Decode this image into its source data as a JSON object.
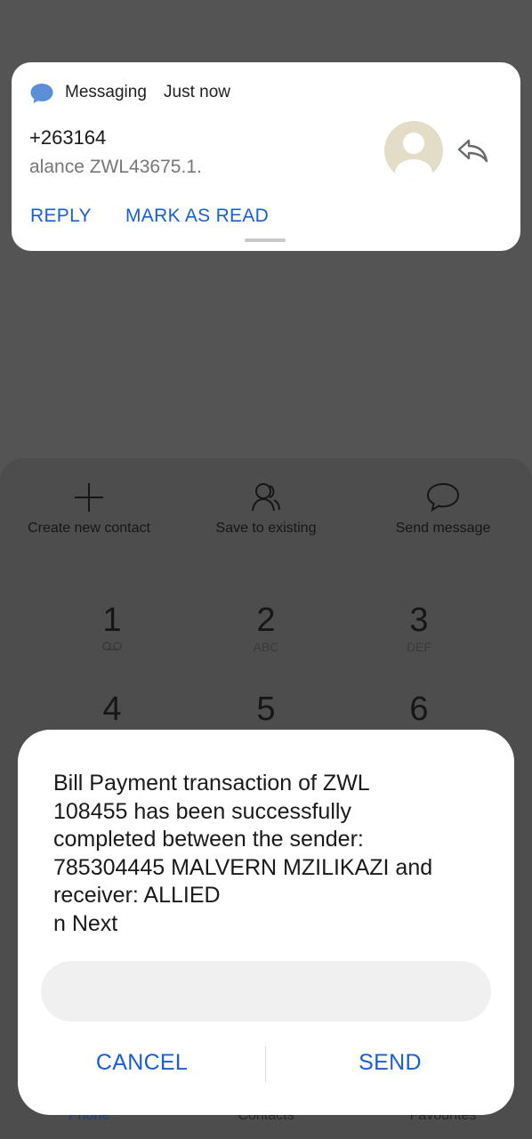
{
  "notification": {
    "app_name": "Messaging",
    "time": "Just now",
    "sender": "+263164",
    "preview": "alance ZWL43675.1.",
    "actions": {
      "reply": "REPLY",
      "mark_read": "MARK AS READ"
    }
  },
  "dialer": {
    "quick_actions": [
      {
        "label": "Create new contact",
        "icon": "plus-icon"
      },
      {
        "label": "Save to existing",
        "icon": "person-icon"
      },
      {
        "label": "Send message",
        "icon": "chat-bubble-icon"
      }
    ],
    "keys": [
      {
        "digit": "1",
        "letters": ""
      },
      {
        "digit": "2",
        "letters": "ABC"
      },
      {
        "digit": "3",
        "letters": "DEF"
      },
      {
        "digit": "4",
        "letters": ""
      },
      {
        "digit": "5",
        "letters": ""
      },
      {
        "digit": "6",
        "letters": ""
      }
    ],
    "bottom_nav": [
      "Phone",
      "Contacts",
      "Favourites"
    ]
  },
  "dialog": {
    "message_lines": [
      "Bill Payment transaction of ZWL",
      "108455 has been successfully",
      "completed between the sender:",
      "785304445 MALVERN MZILIKAZI and",
      "receiver: ALLIED",
      "n Next"
    ],
    "input_value": "",
    "cancel": "CANCEL",
    "send": "SEND"
  },
  "colors": {
    "accent": "#1a5fd0",
    "backdrop": "#545454",
    "card": "#ffffff",
    "avatar_bg": "#e3dcc6"
  }
}
